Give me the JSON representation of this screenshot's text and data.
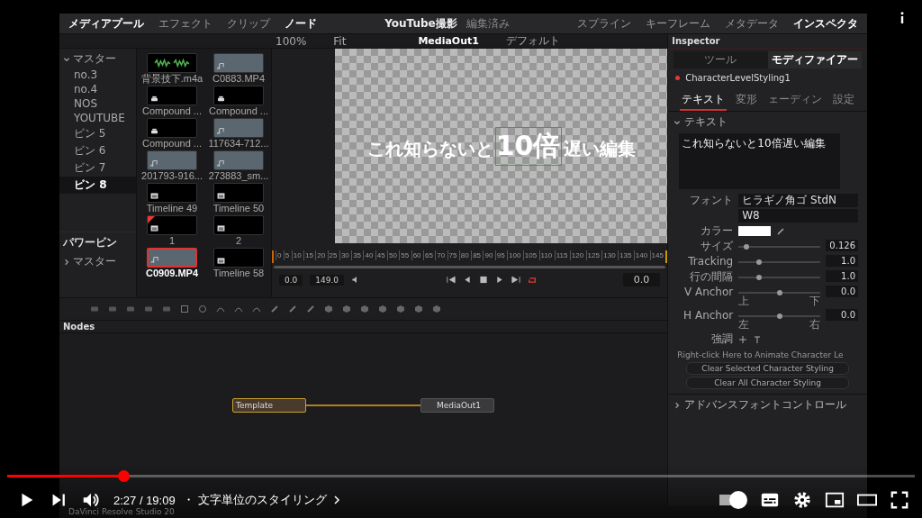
{
  "workspace_left": [
    {
      "label": "メディアプール",
      "selected": true
    },
    {
      "label": "エフェクト",
      "selected": false
    },
    {
      "label": "クリップ",
      "selected": false
    },
    {
      "label": "ノード",
      "selected": true
    }
  ],
  "project": {
    "title": "YouTube撮影",
    "status": "編集済み"
  },
  "workspace_right": [
    {
      "label": "スプライン",
      "selected": false
    },
    {
      "label": "キーフレーム",
      "selected": false
    },
    {
      "label": "メタデータ",
      "selected": false
    },
    {
      "label": "インスペクタ",
      "selected": true
    }
  ],
  "viewer_toolbar": {
    "zoom": "100%",
    "fit": "Fit",
    "node": "MediaOut1",
    "view": "デフォルト"
  },
  "bins": [
    {
      "label": "マスター",
      "expanded": true,
      "children": [
        {
          "label": "no.3",
          "selected": false
        },
        {
          "label": "no.4",
          "selected": false
        },
        {
          "label": "NOS",
          "selected": false
        },
        {
          "label": "YOUTUBE",
          "selected": false
        },
        {
          "label": "ビン 5",
          "selected": false
        },
        {
          "label": "ビン 6",
          "selected": false
        },
        {
          "label": "ビン 7",
          "selected": false
        },
        {
          "label": "ビン 8",
          "selected": true
        }
      ]
    }
  ],
  "power_bins": {
    "title": "パワービン",
    "items": [
      {
        "label": "マスター",
        "expanded": false
      }
    ]
  },
  "clips": [
    {
      "name": "背景技下.m4a",
      "kind": "audio",
      "selected": false,
      "flagged": false
    },
    {
      "name": "C0883.MP4",
      "kind": "video",
      "selected": false,
      "flagged": false
    },
    {
      "name": "Compound ...",
      "kind": "compound",
      "selected": false,
      "flagged": false
    },
    {
      "name": "Compound ...",
      "kind": "compound",
      "selected": false,
      "flagged": false
    },
    {
      "name": "Compound ...",
      "kind": "compound",
      "selected": false,
      "flagged": false
    },
    {
      "name": "117634-712...",
      "kind": "video",
      "selected": false,
      "flagged": false
    },
    {
      "name": "201793-916...",
      "kind": "video",
      "selected": false,
      "flagged": false
    },
    {
      "name": "273883_sm...",
      "kind": "video",
      "selected": false,
      "flagged": false
    },
    {
      "name": "Timeline 49",
      "kind": "timeline",
      "selected": false,
      "flagged": false
    },
    {
      "name": "Timeline 50",
      "kind": "timeline",
      "selected": false,
      "flagged": false
    },
    {
      "name": "1",
      "kind": "timeline",
      "selected": false,
      "flagged": true
    },
    {
      "name": "2",
      "kind": "timeline",
      "selected": false,
      "flagged": false
    },
    {
      "name": "C0909.MP4",
      "kind": "video",
      "selected": true,
      "flagged": false
    },
    {
      "name": "Timeline 58",
      "kind": "timeline",
      "selected": false,
      "flagged": false
    }
  ],
  "viewer": {
    "text_before": "これ知らないと",
    "text_emphasis": "10倍",
    "text_after": "遅い編集"
  },
  "ruler_ticks": [
    "0",
    "5",
    "10",
    "15",
    "20",
    "25",
    "30",
    "35",
    "40",
    "45",
    "50",
    "55",
    "60",
    "65",
    "70",
    "75",
    "80",
    "85",
    "90",
    "95",
    "100",
    "105",
    "110",
    "115",
    "120",
    "125",
    "130",
    "135",
    "140",
    "145"
  ],
  "transport": {
    "start": "0.0",
    "end": "149.0",
    "current": "0.0",
    "loop": true
  },
  "nodes_panel": {
    "title": "Nodes",
    "nodes": [
      {
        "label": "Template",
        "selected": true
      },
      {
        "label": "MediaOut1",
        "selected": false
      }
    ]
  },
  "inspector": {
    "title": "Inspector",
    "tabs": [
      {
        "label": "ツール",
        "selected": false
      },
      {
        "label": "モディファイアー",
        "selected": true
      }
    ],
    "tool_name": "CharacterLevelStyling1",
    "sub_tabs": [
      {
        "label": "テキスト",
        "selected": true
      },
      {
        "label": "変形",
        "selected": false
      },
      {
        "label": "ェーディン",
        "selected": false
      },
      {
        "label": "設定",
        "selected": false
      }
    ],
    "section": {
      "title": "テキスト",
      "expanded": true
    },
    "text_value": "これ知らないと10倍遅い編集",
    "font_label": "フォント",
    "font": "ヒラギノ角ゴ StdN",
    "style": "W8",
    "color_label": "カラー",
    "sliders": [
      {
        "label": "サイズ",
        "level": 0.1,
        "value": "0.126"
      },
      {
        "label": "Tracking",
        "level": 0.25,
        "value": "1.0"
      },
      {
        "label": "行の間隔",
        "level": 0.25,
        "value": "1.0"
      },
      {
        "label": "V Anchor",
        "level": 0.5,
        "value": "0.0",
        "min_label": "上",
        "max_label": "下"
      },
      {
        "label": "H Anchor",
        "level": 0.5,
        "value": "0.0",
        "min_label": "左",
        "max_label": "右"
      }
    ],
    "emphasis_label": "強調",
    "animate_hint": "Right-click Here to Animate Character Le",
    "buttons": [
      "Clear Selected Character Styling",
      "Clear All Character Styling"
    ],
    "advanced": {
      "title": "アドバンスフォントコントロール",
      "expanded": false
    }
  },
  "app_footer": "DaVinci Resolve Studio 20",
  "player": {
    "level": 0.128,
    "time": "2:27 / 19:09",
    "chapter": "・ 文字単位のスタイリング",
    "autoplay": true
  }
}
